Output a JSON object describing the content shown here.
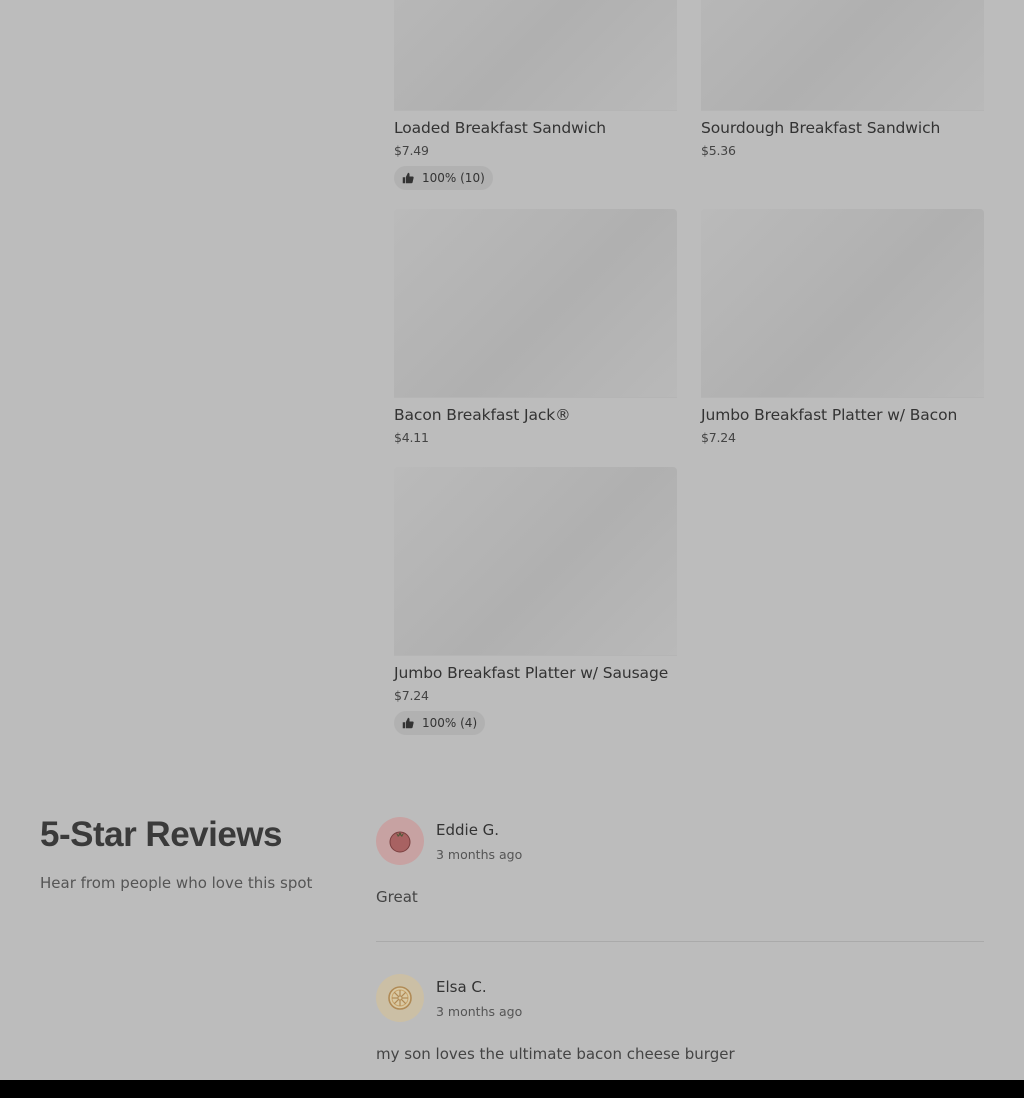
{
  "menu": {
    "items": [
      {
        "name": "Loaded Breakfast Sandwich",
        "price": "$7.49",
        "rating": "100% (10)"
      },
      {
        "name": "Sourdough Breakfast Sandwich",
        "price": "$5.36"
      },
      {
        "name": "Bacon Breakfast Jack®",
        "price": "$4.11"
      },
      {
        "name": "Jumbo Breakfast Platter w/ Bacon",
        "price": "$7.24"
      },
      {
        "name": "Jumbo Breakfast Platter w/ Sausage",
        "price": "$7.24",
        "rating": "100% (4)"
      }
    ],
    "rating_icon": "thumbs-up-icon"
  },
  "reviews": {
    "title": "5-Star Reviews",
    "subtitle": "Hear from people who love this spot",
    "items": [
      {
        "author": "Eddie G.",
        "time": "3 months ago",
        "text": "Great",
        "avatar_icon": "tomato-icon",
        "avatar_color": "#c7a2a2"
      },
      {
        "author": "Elsa C.",
        "time": "3 months ago",
        "text": "my son loves the ultimate bacon cheese burger",
        "avatar_icon": "citrus-slice-icon",
        "avatar_color": "#cbbfa5"
      }
    ]
  },
  "colors": {
    "overlay_background": "#bcbcbc",
    "bottom_bar": "#000000"
  }
}
